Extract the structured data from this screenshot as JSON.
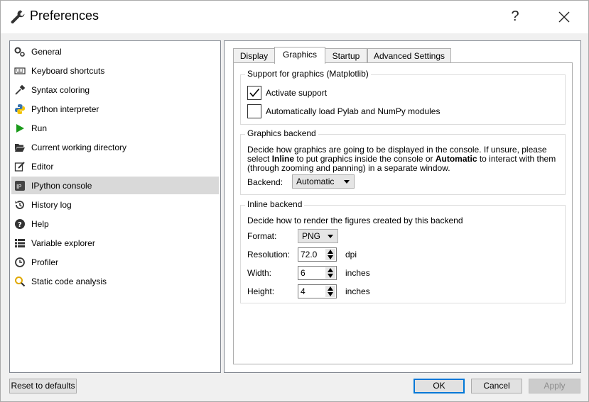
{
  "window": {
    "title": "Preferences",
    "help_glyph": "?",
    "icons": {
      "title": "wrench-icon",
      "close": "close-icon"
    }
  },
  "sidebar": {
    "items": [
      {
        "label": "General",
        "icon": "gears-icon"
      },
      {
        "label": "Keyboard shortcuts",
        "icon": "keyboard-icon"
      },
      {
        "label": "Syntax coloring",
        "icon": "eyedropper-icon"
      },
      {
        "label": "Python interpreter",
        "icon": "python-icon"
      },
      {
        "label": "Run",
        "icon": "play-icon"
      },
      {
        "label": "Current working directory",
        "icon": "folder-open-icon"
      },
      {
        "label": "Editor",
        "icon": "edit-icon"
      },
      {
        "label": "IPython console",
        "icon": "ipython-icon",
        "selected": true
      },
      {
        "label": "History log",
        "icon": "history-icon"
      },
      {
        "label": "Help",
        "icon": "question-circle-icon"
      },
      {
        "label": "Variable explorer",
        "icon": "list-icon"
      },
      {
        "label": "Profiler",
        "icon": "clock-icon"
      },
      {
        "label": "Static code analysis",
        "icon": "search-icon"
      }
    ]
  },
  "tabs": [
    {
      "label": "Display"
    },
    {
      "label": "Graphics",
      "active": true
    },
    {
      "label": "Startup"
    },
    {
      "label": "Advanced Settings"
    }
  ],
  "support_group": {
    "title": "Support for graphics (Matplotlib)",
    "activate_label": "Activate support",
    "activate_checked": true,
    "autoload_label": "Automatically load Pylab and NumPy modules",
    "autoload_checked": false
  },
  "backend_group": {
    "title": "Graphics backend",
    "desc_line1": "Decide how graphics are going to be displayed in the console. If unsure, please",
    "desc_line2_a": "select ",
    "desc_line2_b": "Inline",
    "desc_line2_c": " to put graphics inside the console or ",
    "desc_line2_d": "Automatic",
    "desc_line2_e": " to interact with them",
    "desc_line3": "(through zooming and panning) in a separate window.",
    "backend_label": "Backend:",
    "backend_value": "Automatic"
  },
  "inline_group": {
    "title": "Inline backend",
    "desc": "Decide how to render the figures created by this backend",
    "format_label": "Format:",
    "format_value": "PNG",
    "resolution_label": "Resolution:",
    "resolution_value": "72.0",
    "resolution_unit": "dpi",
    "width_label": "Width:",
    "width_value": "6",
    "width_unit": "inches",
    "height_label": "Height:",
    "height_value": "4",
    "height_unit": "inches"
  },
  "footer": {
    "reset_label": "Reset to defaults",
    "ok_label": "OK",
    "cancel_label": "Cancel",
    "apply_label": "Apply"
  },
  "colors": {
    "accent": "#0078d7",
    "selection": "#d9d9d9",
    "run_green": "#1a9a1a"
  }
}
